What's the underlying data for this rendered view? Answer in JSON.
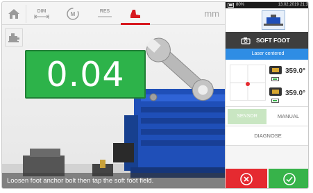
{
  "toolbar": {
    "dim_label": "DIM",
    "res_label": "RES",
    "unit": "mm"
  },
  "measurement": {
    "value": "0.04"
  },
  "instruction": "Loosen foot anchor bolt then tap the soft foot field.",
  "panel": {
    "status": {
      "battery": "80%",
      "datetime": "13.02.2019 21:3"
    },
    "mode_title": "SOFT FOOT",
    "laser_status": "Laser centered",
    "sensor_angle_top": "359.0°",
    "sensor_angle_bottom": "359.0°",
    "sensor_button": "SENSOR",
    "manual_button": "MANUAL",
    "diagnose_button": "DIAGNOSE"
  },
  "colors": {
    "accent_red": "#d71920",
    "value_green": "#2db34a",
    "laser_blue": "#2f8de4",
    "machine_blue": "#1f4fb8"
  }
}
